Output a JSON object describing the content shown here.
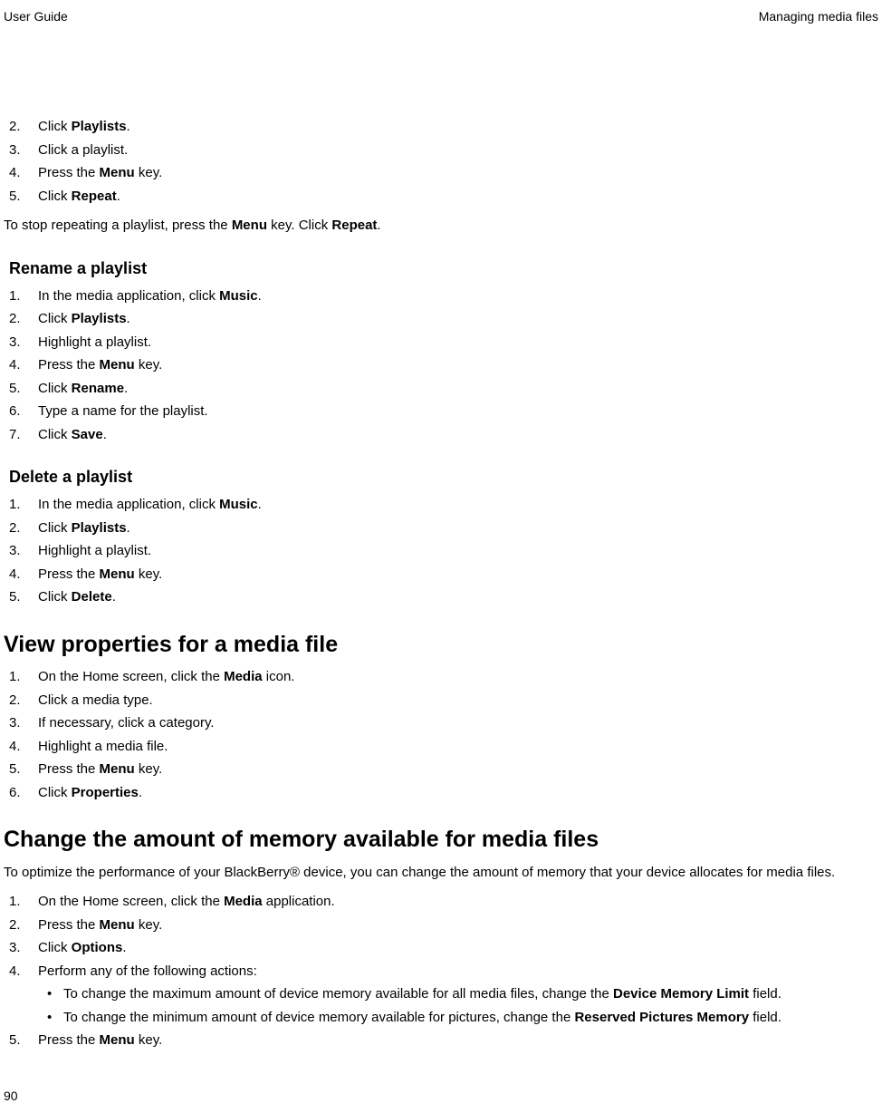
{
  "header": {
    "left": "User Guide",
    "right": "Managing media files"
  },
  "page_number": "90",
  "section_a": {
    "items": [
      {
        "n": "2.",
        "parts": [
          "Click ",
          "Playlists",
          "."
        ]
      },
      {
        "n": "3.",
        "parts": [
          "Click a playlist."
        ]
      },
      {
        "n": "4.",
        "parts": [
          "Press the ",
          "Menu",
          " key."
        ]
      },
      {
        "n": "5.",
        "parts": [
          "Click ",
          "Repeat",
          "."
        ]
      }
    ],
    "para_parts": [
      "To stop repeating a playlist, press the ",
      "Menu",
      " key. Click ",
      "Repeat",
      "."
    ]
  },
  "rename": {
    "title": "Rename a playlist",
    "items": [
      {
        "n": "1.",
        "parts": [
          "In the media application, click ",
          "Music",
          "."
        ]
      },
      {
        "n": "2.",
        "parts": [
          "Click ",
          "Playlists",
          "."
        ]
      },
      {
        "n": "3.",
        "parts": [
          "Highlight a playlist."
        ]
      },
      {
        "n": "4.",
        "parts": [
          "Press the ",
          "Menu",
          " key."
        ]
      },
      {
        "n": "5.",
        "parts": [
          "Click ",
          "Rename",
          "."
        ]
      },
      {
        "n": "6.",
        "parts": [
          "Type a name for the playlist."
        ]
      },
      {
        "n": "7.",
        "parts": [
          "Click ",
          "Save",
          "."
        ]
      }
    ]
  },
  "delete": {
    "title": "Delete a playlist",
    "items": [
      {
        "n": "1.",
        "parts": [
          "In the media application, click ",
          "Music",
          "."
        ]
      },
      {
        "n": "2.",
        "parts": [
          "Click ",
          "Playlists",
          "."
        ]
      },
      {
        "n": "3.",
        "parts": [
          "Highlight a playlist."
        ]
      },
      {
        "n": "4.",
        "parts": [
          "Press the ",
          "Menu",
          " key."
        ]
      },
      {
        "n": "5.",
        "parts": [
          "Click ",
          "Delete",
          "."
        ]
      }
    ]
  },
  "view_props": {
    "title": "View properties for a media file",
    "items": [
      {
        "n": "1.",
        "parts": [
          "On the Home screen, click the ",
          "Media",
          " icon."
        ]
      },
      {
        "n": "2.",
        "parts": [
          "Click a media type."
        ]
      },
      {
        "n": "3.",
        "parts": [
          "If necessary, click a category."
        ]
      },
      {
        "n": "4.",
        "parts": [
          "Highlight a media file."
        ]
      },
      {
        "n": "5.",
        "parts": [
          "Press the ",
          "Menu",
          " key."
        ]
      },
      {
        "n": "6.",
        "parts": [
          "Click ",
          "Properties",
          "."
        ]
      }
    ]
  },
  "change_mem": {
    "title": "Change the amount of memory available for media files",
    "intro": "To optimize the performance of your BlackBerry® device, you can change the amount of memory that your device allocates for media files.",
    "items": [
      {
        "n": "1.",
        "parts": [
          "On the Home screen, click the ",
          "Media",
          " application."
        ]
      },
      {
        "n": "2.",
        "parts": [
          "Press the ",
          "Menu",
          " key."
        ]
      },
      {
        "n": "3.",
        "parts": [
          "Click ",
          "Options",
          "."
        ]
      },
      {
        "n": "4.",
        "parts": [
          "Perform any of the following actions:"
        ],
        "subs": [
          {
            "parts": [
              "To change the maximum amount of device memory available for all media files, change the ",
              "Device Memory Limit",
              " field."
            ]
          },
          {
            "parts": [
              "To change the minimum amount of device memory available for pictures, change the ",
              "Reserved Pictures Memory",
              " field."
            ]
          }
        ]
      },
      {
        "n": "5.",
        "parts": [
          "Press the ",
          "Menu",
          " key."
        ]
      }
    ]
  }
}
